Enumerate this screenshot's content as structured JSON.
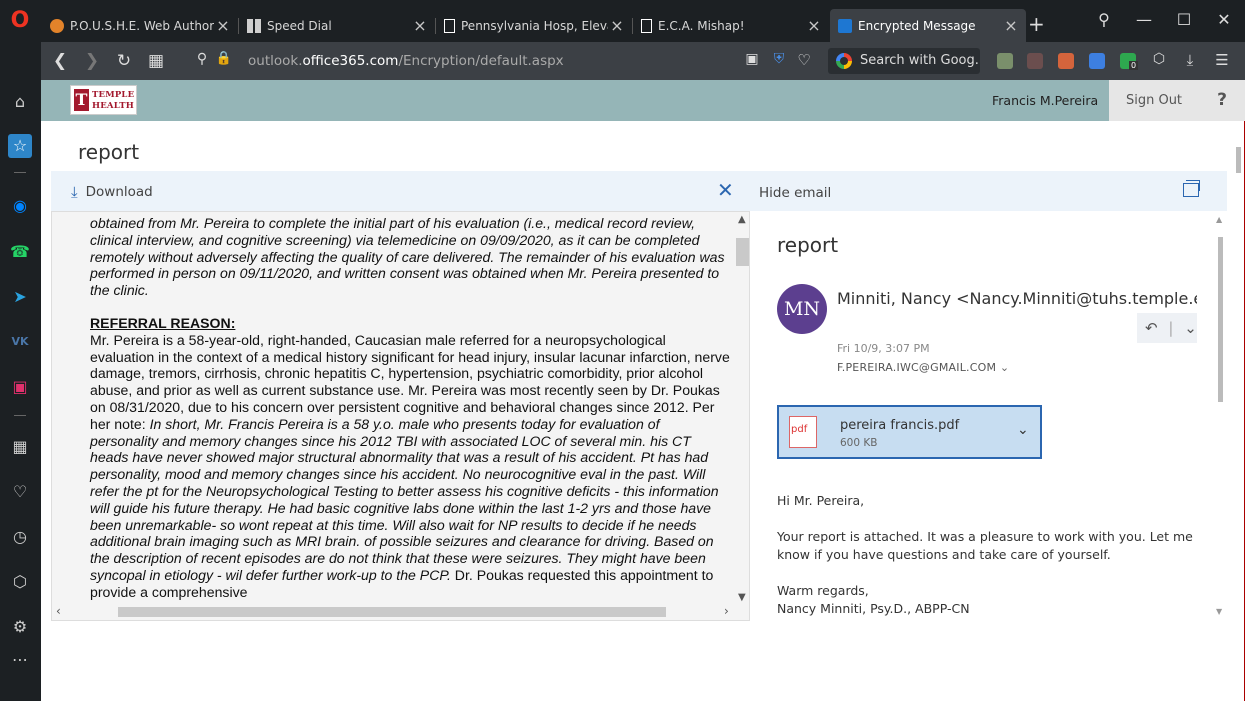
{
  "tabs": [
    {
      "label": "P.O.U.S.H.E. Web Authoring",
      "color": "#e2832a"
    },
    {
      "label": "Speed Dial",
      "color": "#cfcfcf"
    },
    {
      "label": "Pennsylvania Hosp, Elevato",
      "color": "#ffffff"
    },
    {
      "label": "E.C.A. Mishap!",
      "color": "#ffffff"
    },
    {
      "label": "Encrypted Message",
      "color": "#1e77d2"
    }
  ],
  "address": {
    "prefix": "outlook.",
    "domain": "office365.com",
    "path": "/Encryption/default.aspx"
  },
  "search": {
    "label": "Search with Goog..."
  },
  "extension_badge": "0",
  "header": {
    "user_name": "Francis M.Pereira",
    "sign_out": "Sign Out",
    "help": "?",
    "logo_line1": "TEMPLE",
    "logo_line2": "HEALTH",
    "logo_letter": "T"
  },
  "page_title": "report",
  "toolbar": {
    "download": "Download",
    "hide_email": "Hide email"
  },
  "document": {
    "p1": "obtained from Mr. Pereira to complete the initial part of his evaluation (i.e., medical record review, clinical interview, and cognitive screening) via telemedicine on 09/09/2020, as it can be completed remotely without adversely affecting the quality of care delivered. The remainder of his evaluation was performed in person on 09/11/2020, and written consent was obtained when Mr. Pereira presented to the clinic.",
    "heading": "REFERRAL REASON:",
    "p2_plain": "Mr. Pereira is a 58-year-old, right-handed, Caucasian male referred for a neuropsychological evaluation in the context of a medical history significant for head injury, insular lacunar infarction, nerve damage, tremors, cirrhosis, chronic hepatitis C, hypertension, psychiatric comorbidity, prior alcohol abuse, and prior as well as current substance use. Mr. Pereira was most recently seen by Dr. Poukas on 08/31/2020, due to his concern over persistent cognitive and behavioral changes since 2012. Per her note: ",
    "p2_italic": "In short, Mr. Francis Pereira is a 58 y.o. male who presents today for evaluation of personality and memory changes since his 2012 TBI with associated LOC of several min.  his CT heads have never showed major structural abnormality that was a result of his accident. Pt has had personality, mood and memory changes since his accident.  No neurocognitive eval in the past.  Will refer the pt for the Neuropsychological Testing to better assess his cognitive deficits - this information will guide his future therapy. He had basic cognitive labs done within the last 1-2 yrs and those have been unremarkable- so wont repeat at this time. Will also wait for NP results to decide if he needs additional brain imaging such as MRI brain. of possible seizures and clearance for driving.  Based on the description of recent episodes are do not think that these were seizures.  They might have been syncopal in etiology - wil defer further work-up to the PCP.",
    "p2_tail": "  Dr. Poukas requested this appointment to provide a comprehensive"
  },
  "email": {
    "title": "report",
    "avatar_initials": "MN",
    "sender": "Minniti, Nancy <Nancy.Minniti@tuhs.temple.edu>",
    "date": "Fri 10/9, 3:07 PM",
    "to": "F.PEREIRA.IWC@GMAIL.COM",
    "attachment": {
      "name": "pereira francis.pdf",
      "size": "600 KB",
      "icon_text": "pdf"
    },
    "body": {
      "greeting": "Hi Mr. Pereira,",
      "line1": "Your report is attached. It was a pleasure to work with you. Let me",
      "line2": "know if you have questions and take care of yourself.",
      "closing": "Warm regards,",
      "signature": "Nancy Minniti, Psy.D., ABPP-CN"
    }
  },
  "colors": {
    "accent": "#2b66b0",
    "header_bg": "#95b5b7",
    "avatar": "#5c3f8f",
    "temple_red": "#a3192e"
  }
}
